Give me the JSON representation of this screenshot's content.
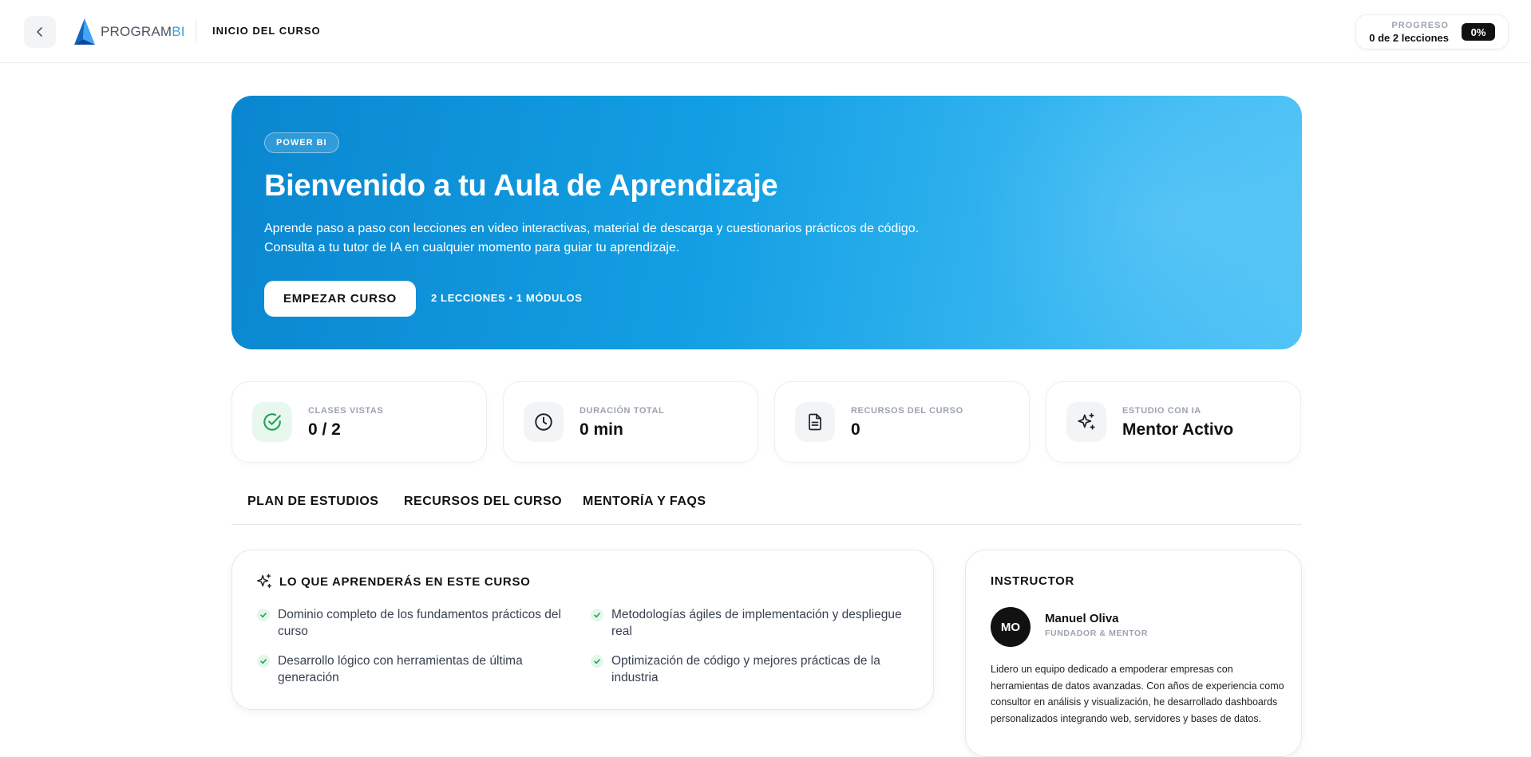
{
  "header": {
    "logo_text": "PROGRAM",
    "logo_text_accent": "BI",
    "page_title": "INICIO DEL CURSO",
    "progress_label": "PROGRESO",
    "progress_count": "0 de 2 lecciones",
    "progress_percent": "0%"
  },
  "hero": {
    "tag": "POWER BI",
    "title": "Bienvenido a tu Aula de Aprendizaje",
    "desc_line1": "Aprende paso a paso con lecciones en video interactivas, material de descarga y cuestionarios prácticos de código.",
    "desc_line2": "Consulta a tu tutor de IA en cualquier momento para guiar tu aprendizaje.",
    "cta_label": "EMPEZAR CURSO",
    "meta": "2 LECCIONES • 1 MÓDULOS"
  },
  "stats": [
    {
      "label": "CLASES VISTAS",
      "value": "0 / 2",
      "icon": "check-circle-icon"
    },
    {
      "label": "DURACIÓN TOTAL",
      "value": "0 min",
      "icon": "clock-icon"
    },
    {
      "label": "RECURSOS DEL CURSO",
      "value": "0",
      "icon": "document-icon"
    },
    {
      "label": "ESTUDIO CON IA",
      "value": "Mentor Activo",
      "icon": "sparkles-icon"
    }
  ],
  "tabs": [
    {
      "label": "PLAN DE ESTUDIOS"
    },
    {
      "label": "RECURSOS DEL CURSO"
    },
    {
      "label": "MENTORÍA Y FAQS"
    }
  ],
  "learn": {
    "title": "LO QUE APRENDERÁS EN ESTE CURSO",
    "points": [
      {
        "text": "Dominio completo de los fundamentos prácticos del curso"
      },
      {
        "text": "Metodologías ágiles de implementación y despliegue real"
      },
      {
        "text": "Desarrollo lógico con herramientas de última generación"
      },
      {
        "text": "Optimización de código y mejores prácticas de la industria"
      }
    ]
  },
  "instructor": {
    "title": "INSTRUCTOR",
    "initials": "MO",
    "name": "Manuel Oliva",
    "role": "FUNDADOR & MENTOR",
    "bio": "Lidero un equipo dedicado a empoderar empresas con herramientas de datos avanzadas. Con años de experiencia como consultor en análisis y visualización, he desarrollado dashboards personalizados integrando web, servidores y bases de datos."
  },
  "colors": {
    "hero_start": "#0a86cf",
    "hero_end": "#52c4f7",
    "success_green": "#22a35a",
    "dark": "#111111"
  }
}
